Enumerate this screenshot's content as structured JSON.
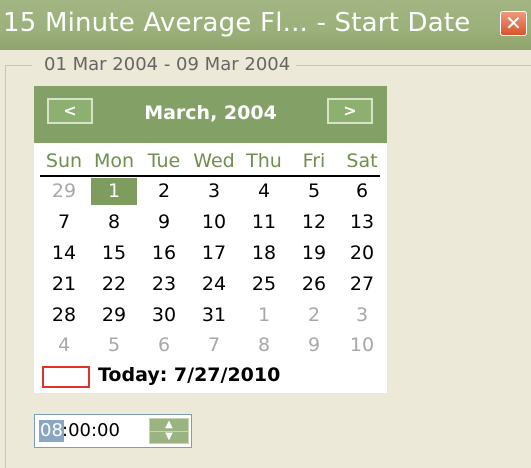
{
  "window": {
    "title": "15 Minute Average Fl... - Start Date",
    "close_label": "✕"
  },
  "range": {
    "text": "01 Mar 2004  -  09 Mar 2004"
  },
  "calendar": {
    "month_label": "March, 2004",
    "prev_label": "<",
    "next_label": ">",
    "weekdays": [
      "Sun",
      "Mon",
      "Tue",
      "Wed",
      "Thu",
      "Fri",
      "Sat"
    ],
    "weeks": [
      [
        "29",
        "1",
        "2",
        "3",
        "4",
        "5",
        "6"
      ],
      [
        "7",
        "8",
        "9",
        "10",
        "11",
        "12",
        "13"
      ],
      [
        "14",
        "15",
        "16",
        "17",
        "18",
        "19",
        "20"
      ],
      [
        "21",
        "22",
        "23",
        "24",
        "25",
        "26",
        "27"
      ],
      [
        "28",
        "29",
        "30",
        "31",
        "1",
        "2",
        "3"
      ],
      [
        "4",
        "5",
        "6",
        "7",
        "8",
        "9",
        "10"
      ]
    ],
    "selected_day": "1",
    "today_label": "Today: 7/27/2010",
    "colors": {
      "header": "#83a066",
      "selected": "#7d9c5e",
      "weekday_text": "#6f8f4e",
      "other_month_text": "#a8a8a8",
      "today_marker": "#e0312b"
    }
  },
  "time": {
    "hour": "08",
    "rest": ":00:00"
  }
}
